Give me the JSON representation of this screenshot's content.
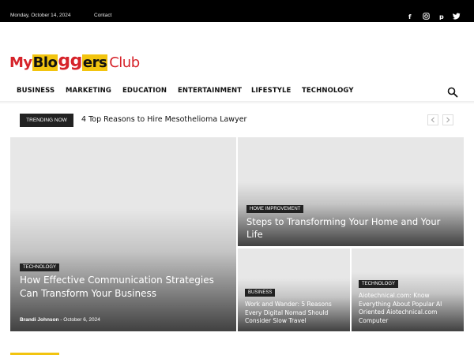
{
  "topbar": {
    "date": "Monday, October 14, 2024",
    "contact": "Contact",
    "social": [
      "facebook-icon",
      "instagram-icon",
      "pinterest-icon",
      "twitter-icon"
    ]
  },
  "logo": {
    "my": "My",
    "blo": "Blo",
    "gg": "gg",
    "ers": "ers",
    "club": "Club"
  },
  "nav": {
    "items": [
      "BUSINESS",
      "MARKETING",
      "EDUCATION",
      "ENTERTAINMENT",
      "LIFESTYLE",
      "TECHNOLOGY"
    ],
    "search_icon": "search-icon"
  },
  "trending": {
    "label": "TRENDING NOW",
    "headline": "4 Top Reasons to Hire Mesothelioma Lawyer",
    "prev_icon": "chevron-left-icon",
    "next_icon": "chevron-right-icon"
  },
  "tiles": {
    "big": {
      "category": "TECHNOLOGY",
      "title": "How Effective Communication Strategies Can Transform Your Business",
      "author": "Brandi Johnson",
      "separator": "-",
      "date": "October 6, 2024"
    },
    "top_right": {
      "category": "HOME IMPROVEMENT",
      "title": "Steps to Transforming Your Home and Your Life"
    },
    "small_left": {
      "category": "BUSINESS",
      "title": "Work and Wander: 5 Reasons Every Digital Nomad Should Consider Slow Travel"
    },
    "small_right": {
      "category": "TECHNOLOGY",
      "title": "Aiotechnical.com: Know Everything About Popular AI Oriented Aiotechnical.com Computer"
    }
  },
  "colors": {
    "accent": "#f2c40f",
    "brand_red": "#d6232a",
    "dark": "#222222"
  }
}
